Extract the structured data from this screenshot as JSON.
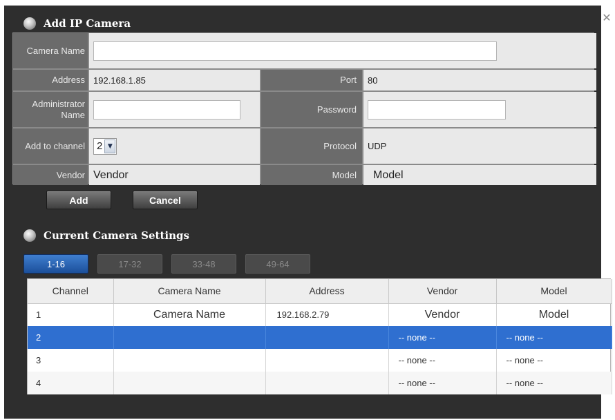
{
  "dialog": {
    "title": "Add IP Camera",
    "close_glyph": "✕",
    "bullet_icon": "sphere-bullet-icon"
  },
  "form": {
    "camera_name_label": "Camera Name",
    "camera_name_value": "",
    "address_label": "Address",
    "address_value": "192.168.1.85",
    "port_label": "Port",
    "port_value": "80",
    "admin_name_label": "Administrator Name",
    "admin_name_value": "",
    "password_label": "Password",
    "password_value": "",
    "channel_label": "Add to channel",
    "channel_value": "2",
    "channel_arrow": "▼",
    "protocol_label": "Protocol",
    "protocol_value": "UDP",
    "vendor_label": "Vendor",
    "vendor_value": "Vendor",
    "model_label": "Model",
    "model_value": "Model"
  },
  "buttons": {
    "add_label": "Add",
    "cancel_label": "Cancel"
  },
  "current_settings": {
    "title": "Current Camera Settings",
    "tabs": [
      "1-16",
      "17-32",
      "33-48",
      "49-64"
    ],
    "active_tab": "1-16",
    "columns": [
      "Channel",
      "Camera Name",
      "Address",
      "Vendor",
      "Model"
    ],
    "rows": [
      {
        "channel": "1",
        "name": "Camera Name",
        "address": "192.168.2.79",
        "vendor": "Vendor",
        "model": "Model"
      },
      {
        "channel": "2",
        "name": "",
        "address": "",
        "vendor": "-- none --",
        "model": "-- none --"
      },
      {
        "channel": "3",
        "name": "",
        "address": "",
        "vendor": "-- none --",
        "model": "-- none --"
      },
      {
        "channel": "4",
        "name": "",
        "address": "",
        "vendor": "-- none --",
        "model": "-- none --"
      }
    ],
    "selected_channel": "2"
  },
  "colors": {
    "dialog_bg": "#2e2e2e",
    "label_bg": "#6b6b6b",
    "value_bg": "#e9e9e9",
    "selected_row": "#2f6fd0",
    "active_tab": "#2a64b8"
  }
}
